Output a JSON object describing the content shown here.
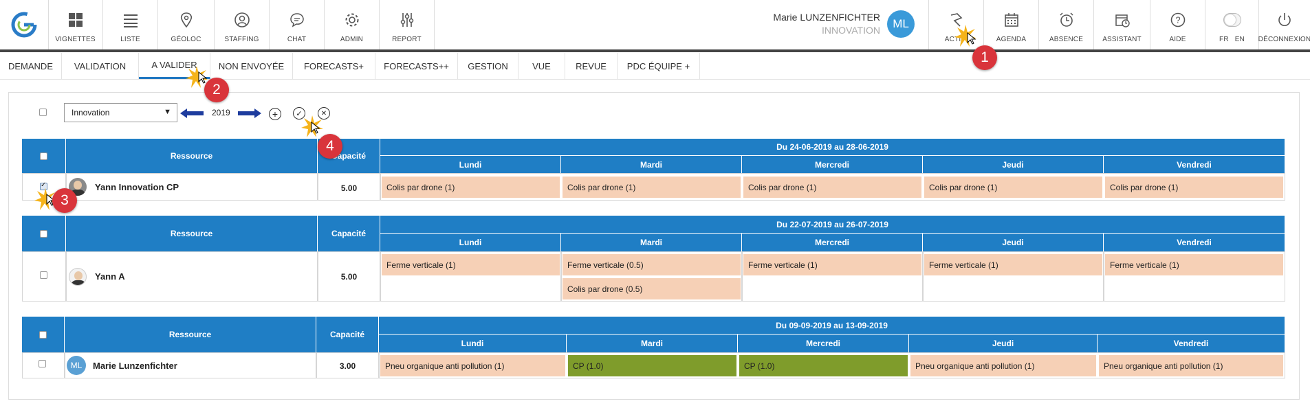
{
  "nav": {
    "items": [
      {
        "label": "VIGNETTES",
        "icon": "grid-icon"
      },
      {
        "label": "LISTE",
        "icon": "list-icon"
      },
      {
        "label": "GÉOLOC",
        "icon": "location-pin-icon"
      },
      {
        "label": "STAFFING",
        "icon": "person-circle-icon"
      },
      {
        "label": "CHAT",
        "icon": "chat-bubble-icon"
      },
      {
        "label": "ADMIN",
        "icon": "gear-icon"
      },
      {
        "label": "REPORT",
        "icon": "sliders-icon"
      }
    ],
    "right_items": [
      {
        "label": "ACTIVI",
        "icon": "activity-icon"
      },
      {
        "label": "AGENDA",
        "icon": "calendar-icon"
      },
      {
        "label": "ABSENCE",
        "icon": "alarm-clock-icon"
      },
      {
        "label": "ASSISTANT",
        "icon": "calendar-clock-icon"
      },
      {
        "label": "AIDE",
        "icon": "help-circle-icon"
      },
      {
        "label": "DÉCONNEXION",
        "icon": "power-icon"
      }
    ],
    "lang_fr": "FR",
    "lang_en": "EN"
  },
  "user": {
    "name": "Marie LUNZENFICHTER",
    "org": "INNOVATION",
    "initials": "ML"
  },
  "tabs": [
    "DEMANDE",
    "VALIDATION",
    "A VALIDER",
    "NON ENVOYÉE",
    "FORECASTS+",
    "FORECASTS++",
    "GESTION",
    "VUE",
    "REVUE",
    "PDC ÉQUIPE +"
  ],
  "active_tab": "A VALIDER",
  "toolbar": {
    "selected_team": "Innovation",
    "year": "2019",
    "caret": "▼",
    "add": "+",
    "validate": "✓",
    "reject": "✕"
  },
  "table_headers": {
    "resource": "Ressource",
    "capacity": "Capacité",
    "days": [
      "Lundi",
      "Mardi",
      "Mercredi",
      "Jeudi",
      "Vendredi"
    ]
  },
  "weeks": [
    {
      "period": "Du 24-06-2019 au 28-06-2019",
      "resource": "Yann Innovation CP",
      "capacity": "5.00",
      "checked": true,
      "tasks": {
        "lundi": [
          "Colis par drone (1)"
        ],
        "mardi": [
          "Colis par drone (1)"
        ],
        "mercredi": [
          "Colis par drone (1)"
        ],
        "jeudi": [
          "Colis par drone (1)"
        ],
        "vendredi": [
          "Colis par drone (1)"
        ]
      }
    },
    {
      "period": "Du 22-07-2019 au 26-07-2019",
      "resource": "Yann A",
      "capacity": "5.00",
      "checked": false,
      "tasks": {
        "lundi": [
          "Ferme verticale (1)"
        ],
        "mardi": [
          "Ferme verticale (0.5)",
          "Colis par drone (0.5)"
        ],
        "mercredi": [
          "Ferme verticale (1)"
        ],
        "jeudi": [
          "Ferme verticale (1)"
        ],
        "vendredi": [
          "Ferme verticale (1)"
        ]
      }
    },
    {
      "period": "Du 09-09-2019 au 13-09-2019",
      "resource": "Marie Lunzenfichter",
      "resource_initials": "ML",
      "capacity": "3.00",
      "checked": false,
      "tasks": {
        "lundi": [
          "Pneu organique anti pollution (1)"
        ],
        "mardi": [
          "CP (1.0)"
        ],
        "mercredi": [
          "CP (1.0)"
        ],
        "jeudi": [
          "Pneu organique anti pollution (1)"
        ],
        "vendredi": [
          "Pneu organique anti pollution (1)"
        ]
      }
    }
  ],
  "annotations": [
    "1",
    "2",
    "3",
    "4"
  ],
  "colors": {
    "header_blue": "#1f7ec5",
    "task_peach": "#f6d0b6",
    "task_green": "#7f9c2b",
    "badge_red": "#d9343b",
    "avatar_blue": "#3a9ad9"
  }
}
